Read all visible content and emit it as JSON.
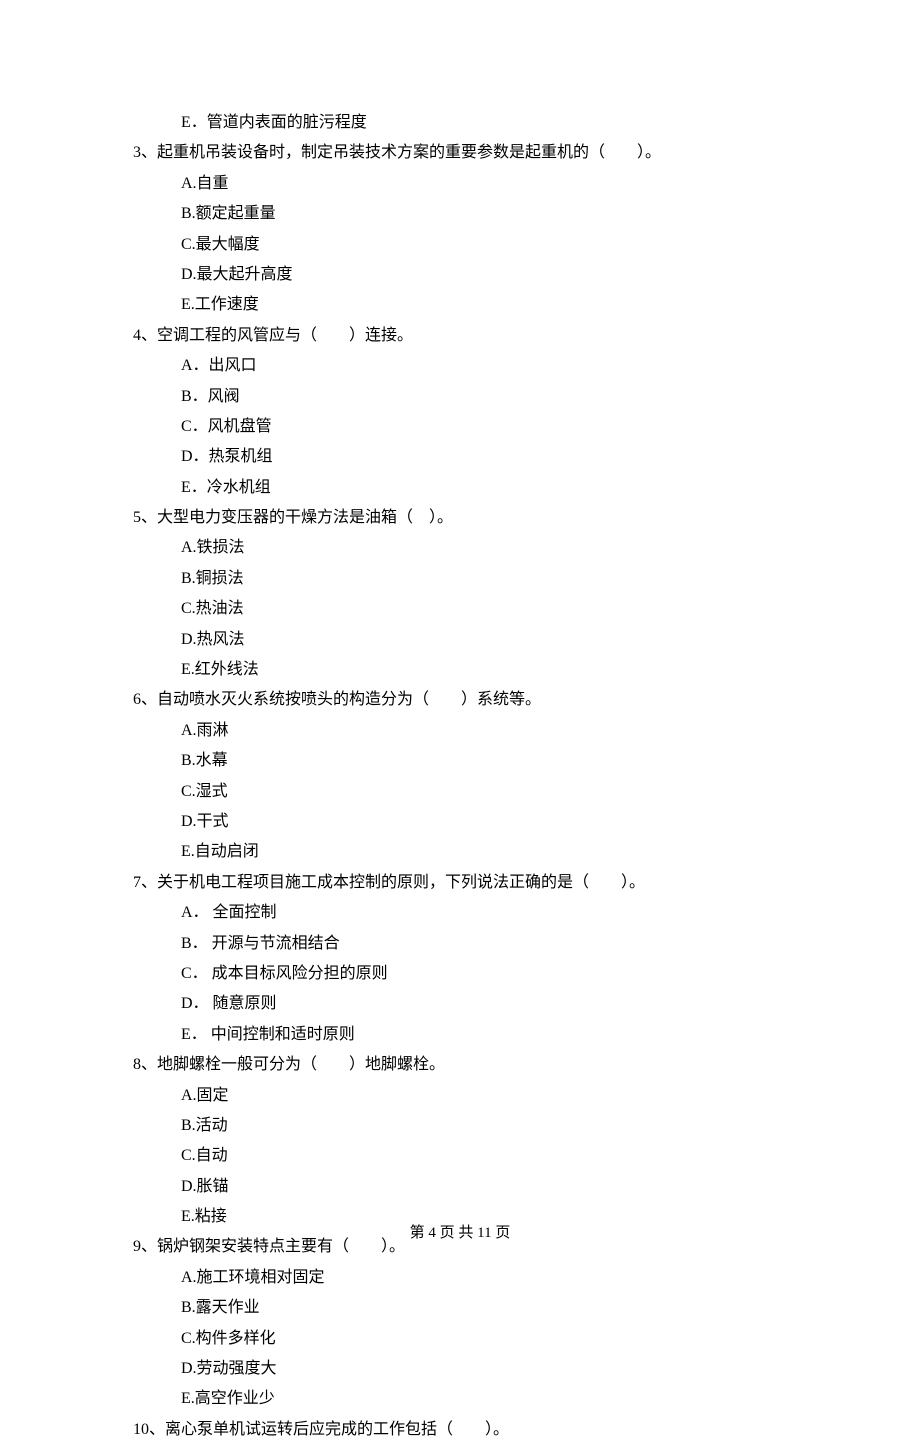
{
  "q2e": "E．管道内表面的脏污程度",
  "q3": {
    "stem": "3、起重机吊装设备时，制定吊装技术方案的重要参数是起重机的（　　）。",
    "opts": [
      "A.自重",
      "B.额定起重量",
      "C.最大幅度",
      "D.最大起升高度",
      "E.工作速度"
    ]
  },
  "q4": {
    "stem": "4、空调工程的风管应与（　　）连接。",
    "opts": [
      "A．出风口",
      "B．风阀",
      "C．风机盘管",
      "D．热泵机组",
      "E．冷水机组"
    ]
  },
  "q5": {
    "stem": "5、大型电力变压器的干燥方法是油箱（　）。",
    "opts": [
      "A.铁损法",
      "B.铜损法",
      "C.热油法",
      "D.热风法",
      "E.红外线法"
    ]
  },
  "q6": {
    "stem": "6、自动喷水灭火系统按喷头的构造分为（　　）系统等。",
    "opts": [
      "A.雨淋",
      "B.水幕",
      "C.湿式",
      "D.干式",
      "E.自动启闭"
    ]
  },
  "q7": {
    "stem": "7、关于机电工程项目施工成本控制的原则，下列说法正确的是（　　）。",
    "opts": [
      "A． 全面控制",
      "B． 开源与节流相结合",
      "C． 成本目标风险分担的原则",
      "D． 随意原则",
      "E． 中间控制和适时原则"
    ]
  },
  "q8": {
    "stem": "8、地脚螺栓一般可分为（　　）地脚螺栓。",
    "opts": [
      "A.固定",
      "B.活动",
      "C.自动",
      "D.胀锚",
      "E.粘接"
    ]
  },
  "q9": {
    "stem": "9、锅炉钢架安装特点主要有（　　）。",
    "opts": [
      "A.施工环境相对固定",
      "B.露天作业",
      "C.构件多样化",
      "D.劳动强度大",
      "E.高空作业少"
    ]
  },
  "q10": {
    "stem": "10、离心泵单机试运转后应完成的工作包括（　　）。"
  },
  "footer": "第 4 页 共 11 页"
}
